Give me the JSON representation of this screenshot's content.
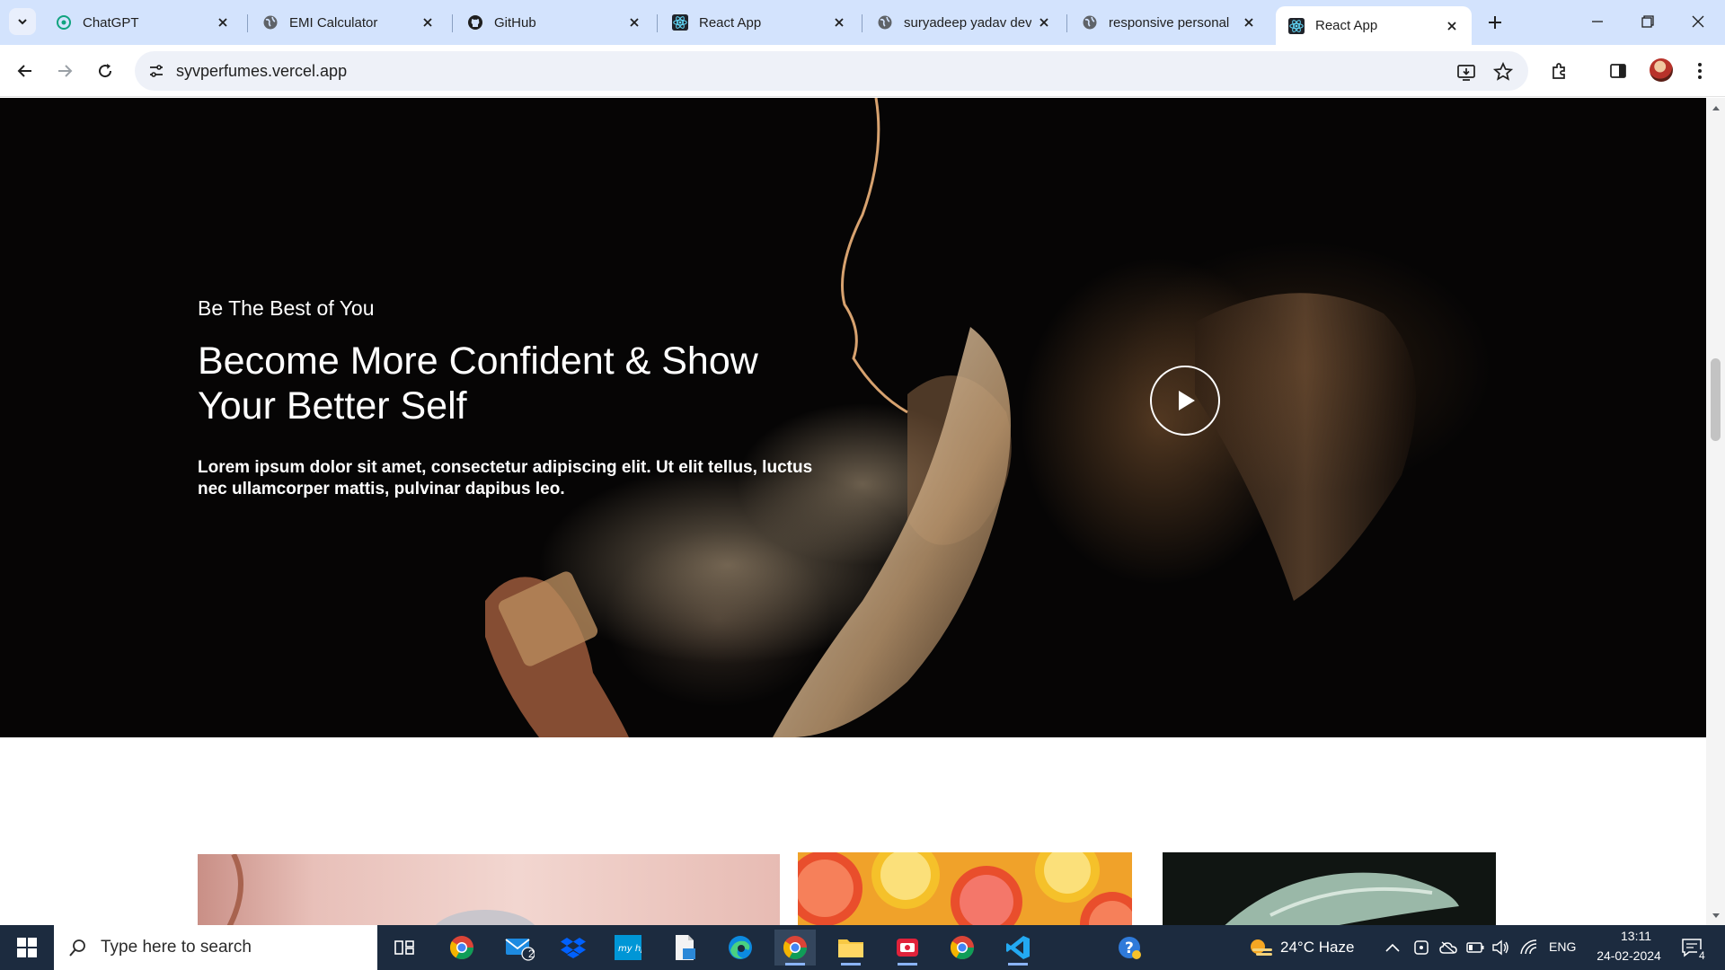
{
  "browser": {
    "tabs": [
      {
        "title": "ChatGPT",
        "icon": "chatgpt-icon",
        "active": false
      },
      {
        "title": "EMI Calculator",
        "icon": "globe-icon",
        "active": false
      },
      {
        "title": "GitHub",
        "icon": "github-icon",
        "active": false
      },
      {
        "title": "React App",
        "icon": "react-icon",
        "active": false
      },
      {
        "title": "suryadeep yadav dev",
        "icon": "globe-icon",
        "active": false
      },
      {
        "title": "responsive personal",
        "icon": "globe-icon",
        "active": false
      },
      {
        "title": "React App",
        "icon": "react-icon",
        "active": true
      }
    ],
    "url": "syvperfumes.vercel.app"
  },
  "hero": {
    "eyebrow": "Be The Best of You",
    "headline": "Become More Confident & Show Your Better Self",
    "description": "Lorem ipsum dolor sit amet, consectetur adipiscing elit. Ut elit tellus, luctus nec ullamcorper mattis, pulvinar dapibus leo."
  },
  "taskbar": {
    "search_placeholder": "Type here to search",
    "mail_badge": "2",
    "weather": "24°C  Haze",
    "language": "ENG",
    "time": "13:11",
    "date": "24-02-2024",
    "notification_count": "4"
  },
  "colors": {
    "tab_strip": "#d3e3fd",
    "hero_bg": "#060505",
    "taskbar": "#1c2b3f"
  }
}
